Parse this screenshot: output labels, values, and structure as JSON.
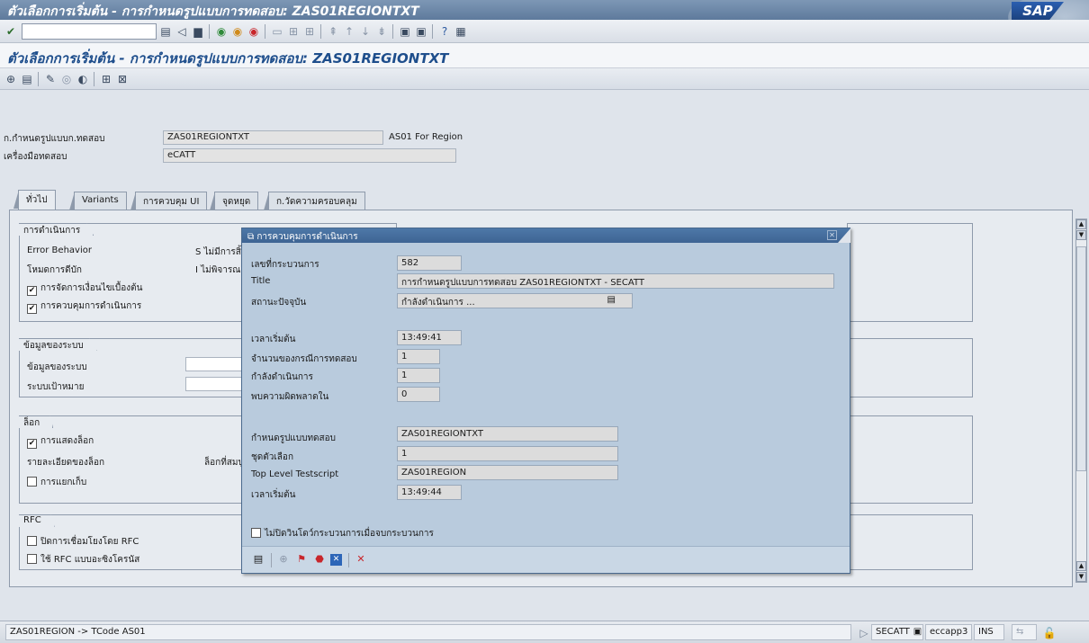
{
  "window": {
    "title": "ตัวเลือกการเริ่มต้น - การกำหนดรูปแบบการทดสอบ: ZAS01REGIONTXT",
    "logo": "SAP"
  },
  "screen": {
    "title": "ตัวเลือกการเริ่มต้น - การกำหนดรูปแบบการทดสอบ: ZAS01REGIONTXT"
  },
  "header": {
    "test_config_label": "ก.กำหนดรูปแบบก.ทดสอบ",
    "test_config_value": "ZAS01REGIONTXT",
    "test_config_desc": "AS01 For Region",
    "test_tool_label": "เครื่องมือทดสอบ",
    "test_tool_value": "eCATT"
  },
  "tabs": [
    {
      "label": "ทั่วไป"
    },
    {
      "label": "Variants"
    },
    {
      "label": "การควบคุม UI"
    },
    {
      "label": "จุดหยุด"
    },
    {
      "label": "ก.วัดความครอบคลุม"
    }
  ],
  "groups": {
    "execution": {
      "title": "การดำเนินการ",
      "error_behavior_label": "Error Behavior",
      "error_behavior_value": "S ไม่มีการสิ้น",
      "debug_mode_label": "โหมดการดีบัก",
      "debug_mode_value": "I ไม่พิจารณา",
      "precondition_label": "การจัดการเงื่อนไขเบื้องต้น",
      "precondition_checked": "✔",
      "exec_control_label": "การควบคุมการดำเนินการ",
      "exec_control_checked": "✔"
    },
    "system_data": {
      "title": "ข้อมูลของระบบ",
      "system_data_label": "ข้อมูลของระบบ",
      "target_system_label": "ระบบเป้าหมาย"
    },
    "log": {
      "title": "ล็อก",
      "show_log_label": "การแสดงล็อก",
      "show_log_checked": "✔",
      "log_detail_label": "รายละเอียดของล็อก",
      "log_detail_value": "ล็อกที่สมบูร",
      "archive_label": "การแยกเก็บ"
    },
    "rfc": {
      "title": "RFC",
      "close_rfc_label": "ปิดการเชื่อมโยงโดย RFC",
      "sync_rfc_label": "ใช้ RFC แบบอะซิงโครนัส"
    }
  },
  "dialog": {
    "title": "การควบคุมการดำเนินการ",
    "close_glyph": "✕",
    "process_no_label": "เลขที่กระบวนการ",
    "process_no_value": "582",
    "title_label": "Title",
    "title_value": "การกำหนดรูปแบบการทดสอบ ZAS01REGIONTXT - SECATT",
    "current_state_label": "สถานะปัจจุบัน",
    "current_state_value": "กำลังดำเนินการ ...",
    "start_time_label": "เวลาเริ่มต้น",
    "start_time_value": "13:49:41",
    "num_test_cases_label": "จำนวนของกรณีการทดสอบ",
    "num_test_cases_value": "1",
    "in_progress_label": "กำลังดำเนินการ",
    "in_progress_value": "1",
    "errors_label": "พบความผิดพลาดใน",
    "errors_value": "0",
    "test_config_label": "กำหนดรูปแบบทดสอบ",
    "test_config_value": "ZAS01REGIONTXT",
    "variant_label": "ชุดตัวเลือก",
    "variant_value": "1",
    "top_script_label": "Top Level Testscript",
    "top_script_value": "ZAS01REGION",
    "start_time2_label": "เวลาเริ่มต้น",
    "start_time2_value": "13:49:44",
    "keep_open_label": "ไม่ปิดวินโดว์กระบวนการเมื่อจบกระบวนการ"
  },
  "status": {
    "message": "ZAS01REGION -> TCode AS01",
    "transaction": "SECATT",
    "server": "eccapp3",
    "mode": "INS"
  },
  "colors": {
    "title_bar": "#5e7a9c",
    "screen_title_text": "#1e4e8c",
    "dialog_bg": "#b9cbdd",
    "dialog_title": "#3e6493"
  }
}
